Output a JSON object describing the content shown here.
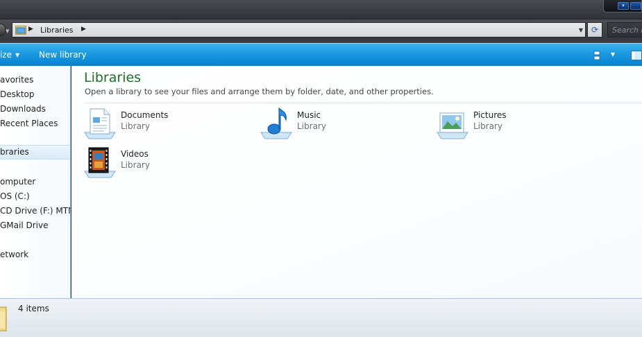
{
  "address_bar": {
    "path_label": "Libraries",
    "search_placeholder": "Search L"
  },
  "toolbar": {
    "organize_label": "ize",
    "new_library_label": "New library"
  },
  "nav_pane": {
    "items": [
      {
        "label": "avorites"
      },
      {
        "label": "Desktop"
      },
      {
        "label": "Downloads"
      },
      {
        "label": "Recent Places"
      },
      {
        "label": "braries"
      },
      {
        "label": "omputer"
      },
      {
        "label": "OS (C:)"
      },
      {
        "label": "CD Drive (F:) MTN F"
      },
      {
        "label": "GMail Drive"
      },
      {
        "label": "etwork"
      }
    ]
  },
  "content": {
    "title": "Libraries",
    "subtitle": "Open a library to see your files and arrange them by folder, date, and other properties.",
    "libraries": [
      {
        "name": "Documents",
        "kind": "Library",
        "icon": "documents-library-icon"
      },
      {
        "name": "Music",
        "kind": "Library",
        "icon": "music-library-icon"
      },
      {
        "name": "Pictures",
        "kind": "Library",
        "icon": "pictures-library-icon"
      },
      {
        "name": "Videos",
        "kind": "Library",
        "icon": "videos-library-icon"
      }
    ]
  },
  "status_bar": {
    "item_count": "4 items"
  },
  "colors": {
    "command_bar": "#1a9ae2",
    "title_green": "#1e6b2a",
    "pane_border": "#7fbfe9"
  }
}
